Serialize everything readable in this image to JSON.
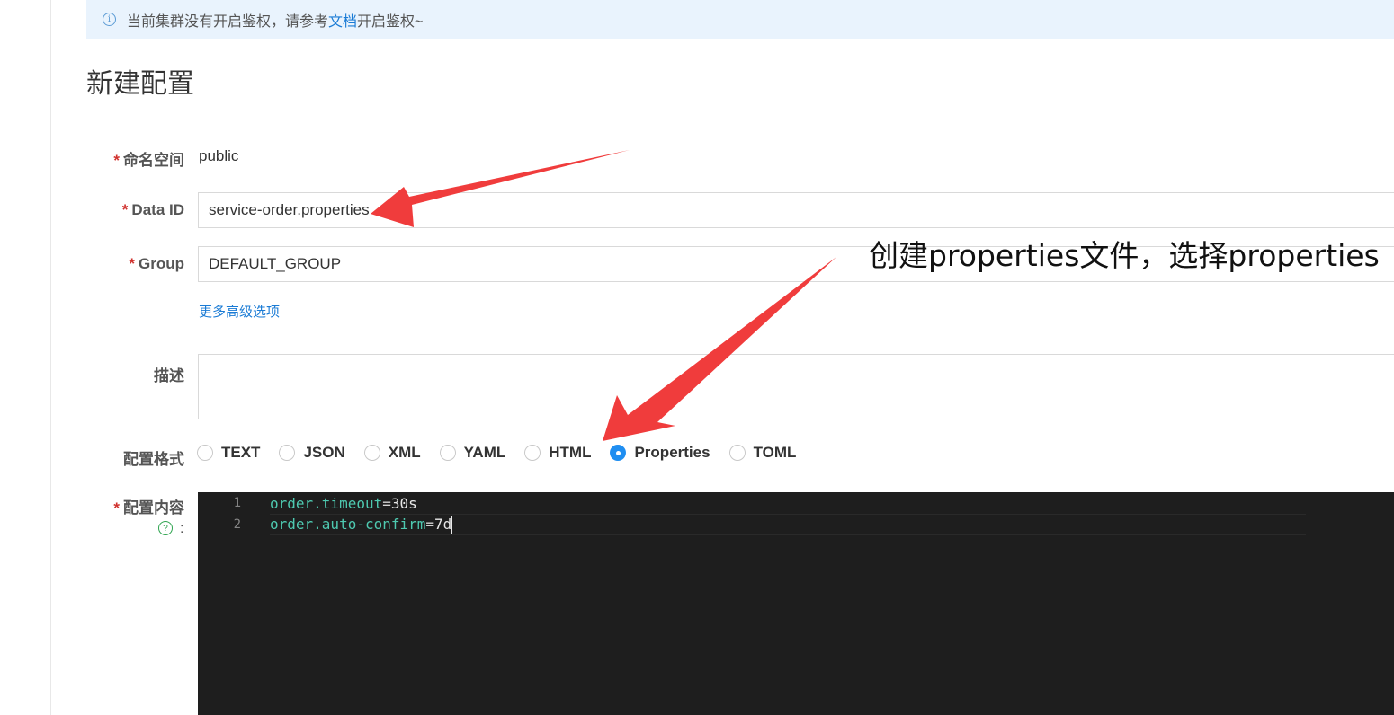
{
  "notice": {
    "text_before": "当前集群没有开启鉴权，请参考",
    "link": "文档",
    "text_after": "开启鉴权~"
  },
  "page_title": "新建配置",
  "form": {
    "namespace": {
      "label": "命名空间",
      "value": "public"
    },
    "data_id": {
      "label": "Data ID",
      "value": "service-order.properties"
    },
    "group": {
      "label": "Group",
      "value": "DEFAULT_GROUP"
    },
    "advanced_link": "更多高级选项",
    "description": {
      "label": "描述",
      "value": ""
    },
    "format": {
      "label": "配置格式",
      "options": [
        "TEXT",
        "JSON",
        "XML",
        "YAML",
        "HTML",
        "Properties",
        "TOML"
      ],
      "selected": "Properties"
    },
    "content": {
      "label": "配置内容",
      "colon": ":",
      "lines": [
        {
          "num": "1",
          "key": "order.timeout",
          "eq": "=",
          "val": "30s"
        },
        {
          "num": "2",
          "key": "order.auto-confirm",
          "eq": "=",
          "val": "7d"
        }
      ]
    }
  },
  "annotation": "创建properties文件，选择properties",
  "colors": {
    "accent": "#1f8ef1",
    "arrow": "#f03c3c",
    "required": "#d0312d",
    "editor_bg": "#1e1e1e",
    "code_key": "#4ec9b0"
  }
}
